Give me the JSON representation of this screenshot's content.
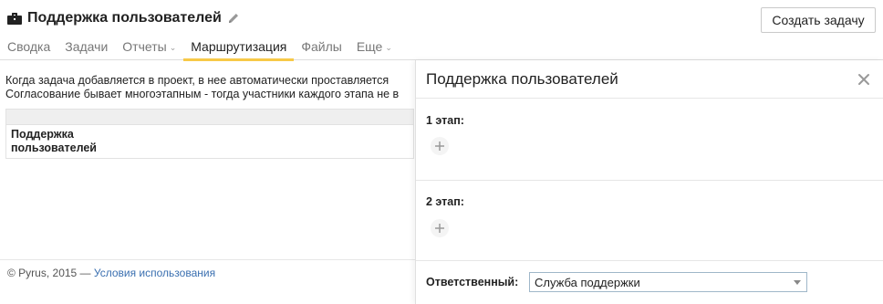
{
  "header": {
    "project_name": "Поддержка пользователей",
    "create_button_label": "Создать задачу"
  },
  "tabs": [
    {
      "label": "Сводка",
      "active": false,
      "dropdown": false
    },
    {
      "label": "Задачи",
      "active": false,
      "dropdown": false
    },
    {
      "label": "Отчеты",
      "active": false,
      "dropdown": true
    },
    {
      "label": "Маршрутизация",
      "active": true,
      "dropdown": false
    },
    {
      "label": "Файлы",
      "active": false,
      "dropdown": false
    },
    {
      "label": "Еще",
      "active": false,
      "dropdown": true
    }
  ],
  "main": {
    "description_line1": "Когда задача добавляется в проект, в нее автоматически проставляется",
    "description_line2": "Согласование бывает многоэтапным - тогда участники каждого этапа не в",
    "table_cell_line1": "Поддержка",
    "table_cell_line2": "пользователей"
  },
  "footer": {
    "copyright": "© Pyrus, 2015 — ",
    "terms_link": "Условия использования"
  },
  "panel": {
    "title": "Поддержка пользователей",
    "stage1_label": "1 этап:",
    "stage2_label": "2 этап:",
    "responsible_label": "Ответственный:",
    "responsible_value": "Служба поддержки"
  },
  "colors": {
    "active_tab_underline": "#f7c948",
    "link": "#3a6fb0",
    "select_border": "#9fb7c9"
  },
  "icons": {
    "project": "briefcase-icon",
    "edit": "pencil-icon",
    "close": "close-icon",
    "add": "plus-icon",
    "dropdown": "chevron-down-icon"
  }
}
